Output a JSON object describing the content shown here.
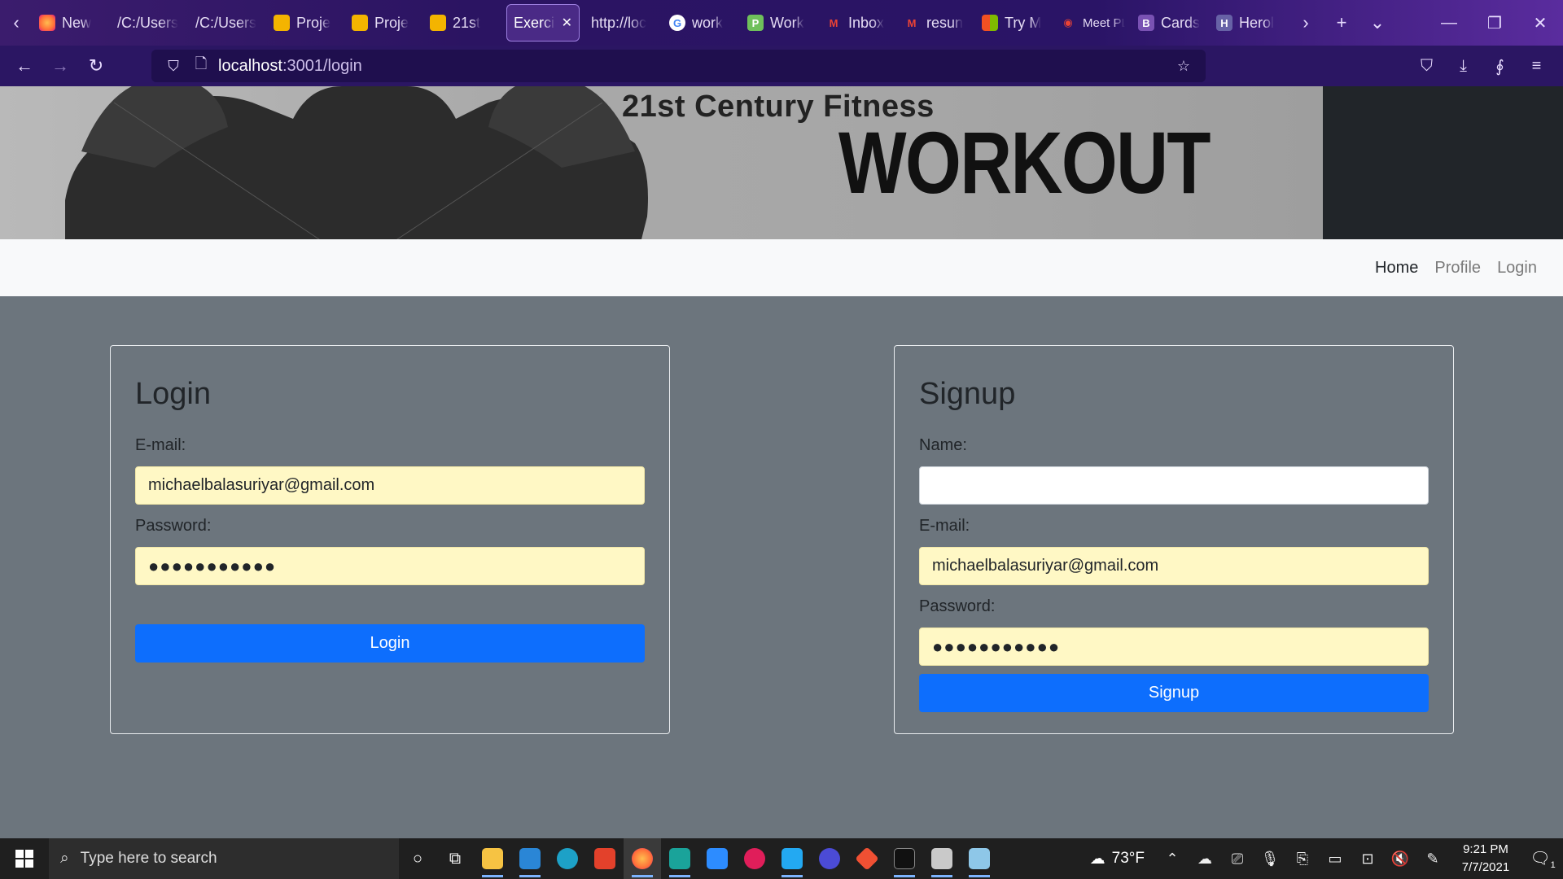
{
  "browser": {
    "tabs": [
      {
        "label": "New",
        "icon": "firefox-icon",
        "color": "#ff7139"
      },
      {
        "label": "/C:/Users",
        "icon": "",
        "color": ""
      },
      {
        "label": "/C:/Users",
        "icon": "",
        "color": ""
      },
      {
        "label": "Proje",
        "icon": "slides-icon",
        "color": "#f4b400"
      },
      {
        "label": "Proje",
        "icon": "slides-icon",
        "color": "#f4b400"
      },
      {
        "label": "21st",
        "icon": "slides-icon",
        "color": "#f4b400"
      },
      {
        "label": "Exercis",
        "icon": "",
        "color": "",
        "active": true
      },
      {
        "label": "http://loc",
        "icon": "",
        "color": ""
      },
      {
        "label": "work",
        "icon": "google-icon",
        "color": "#ffffff"
      },
      {
        "label": "Work",
        "icon": "grammarly-icon",
        "color": "#6fc05b"
      },
      {
        "label": "Inbox",
        "icon": "gmail-icon",
        "color": "#ea4335"
      },
      {
        "label": "resun",
        "icon": "gmail-icon",
        "color": "#ea4335"
      },
      {
        "label": "Try M",
        "icon": "microsoft-icon",
        "color": "#00a4ef"
      },
      {
        "label": "Meet PLAYIN",
        "icon": "meet-icon",
        "color": "#ea4335"
      },
      {
        "label": "Cards",
        "icon": "bootstrap-icon",
        "color": "#7952b3"
      },
      {
        "label": "Herol",
        "icon": "heroku-icon",
        "color": "#6762a6"
      }
    ],
    "url_host": "localhost",
    "url_path": ":3001/login"
  },
  "page": {
    "hero_subtitle": "21st Century Fitness",
    "hero_title": "WORKOUT",
    "nav": {
      "home": "Home",
      "profile": "Profile",
      "login": "Login"
    },
    "login": {
      "title": "Login",
      "email_label": "E-mail:",
      "email_value": "michaelbalasuriyar@gmail.com",
      "password_label": "Password:",
      "password_value": "●●●●●●●●●●●",
      "button": "Login"
    },
    "signup": {
      "title": "Signup",
      "name_label": "Name:",
      "name_value": "",
      "email_label": "E-mail:",
      "email_value": "michaelbalasuriyar@gmail.com",
      "password_label": "Password:",
      "password_value": "●●●●●●●●●●●",
      "button": "Signup"
    }
  },
  "taskbar": {
    "search_placeholder": "Type here to search",
    "weather": "73°F",
    "time": "9:21 PM",
    "date": "7/7/2021",
    "notification_count": "1"
  },
  "colors": {
    "page_bg": "#6c757d",
    "primary": "#0d6efd",
    "autofill": "#fff8c5"
  }
}
